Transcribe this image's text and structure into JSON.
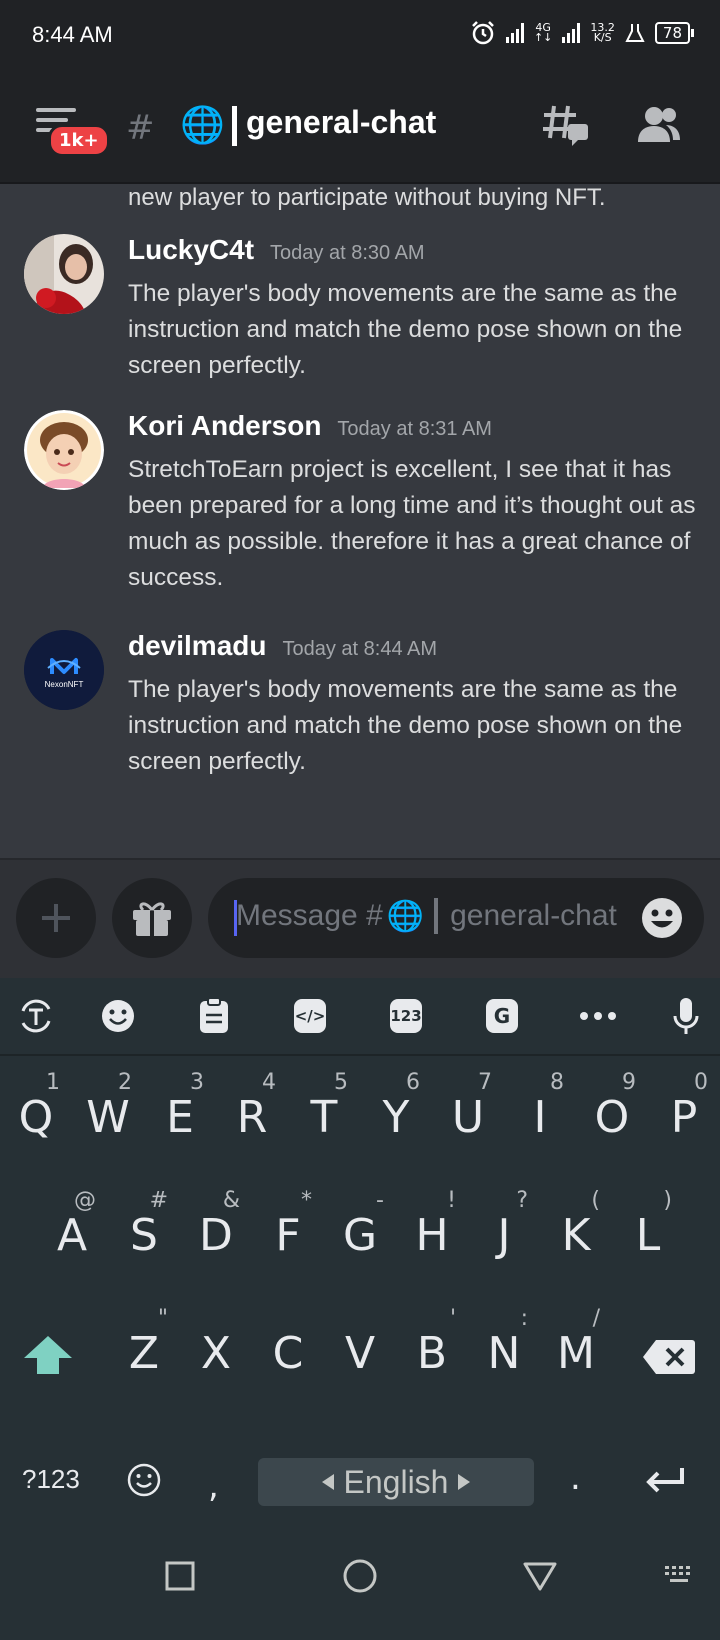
{
  "status_bar": {
    "time": "8:44 AM",
    "network_type": "4G",
    "speed_value": "13.2",
    "speed_unit": "K/S",
    "battery": "78"
  },
  "header": {
    "notification_badge": "1k+",
    "channel_emoji": "🌐",
    "channel_name": "general-chat"
  },
  "messages": {
    "partial_text": "new player to participate without buying NFT.",
    "items": [
      {
        "author": "LuckyC4t",
        "timestamp": "Today at 8:30 AM",
        "text": "The player's body movements are the same as the instruction and match the demo pose shown on the screen perfectly."
      },
      {
        "author": "Kori Anderson",
        "timestamp": "Today at 8:31 AM",
        "text": "StretchToEarn  project is excellent, I see that it has been prepared for a long time and it’s thought out as much as possible. therefore it has a great chance of success."
      },
      {
        "author": "devilmadu",
        "timestamp": "Today at 8:44 AM",
        "avatar_text": "NexonNFT",
        "text": "The player's body movements are the same as the instruction and match the demo pose shown on the screen perfectly."
      }
    ]
  },
  "composer": {
    "placeholder_prefix": "Message #",
    "placeholder_emoji": "🌐",
    "placeholder_channel": "general-chat"
  },
  "keyboard": {
    "toolbar_numbers_label": "123",
    "row1": [
      {
        "key": "Q",
        "hint": "1"
      },
      {
        "key": "W",
        "hint": "2"
      },
      {
        "key": "E",
        "hint": "3"
      },
      {
        "key": "R",
        "hint": "4"
      },
      {
        "key": "T",
        "hint": "5"
      },
      {
        "key": "Y",
        "hint": "6"
      },
      {
        "key": "U",
        "hint": "7"
      },
      {
        "key": "I",
        "hint": "8"
      },
      {
        "key": "O",
        "hint": "9"
      },
      {
        "key": "P",
        "hint": "0"
      }
    ],
    "row2": [
      {
        "key": "A",
        "hint": "@"
      },
      {
        "key": "S",
        "hint": "#"
      },
      {
        "key": "D",
        "hint": "&"
      },
      {
        "key": "F",
        "hint": "*"
      },
      {
        "key": "G",
        "hint": "-"
      },
      {
        "key": "H",
        "hint": "!"
      },
      {
        "key": "J",
        "hint": "?"
      },
      {
        "key": "K",
        "hint": "("
      },
      {
        "key": "L",
        "hint": ")"
      }
    ],
    "row3": [
      {
        "key": "Z",
        "hint": "\""
      },
      {
        "key": "X",
        "hint": ""
      },
      {
        "key": "C",
        "hint": ""
      },
      {
        "key": "V",
        "hint": ""
      },
      {
        "key": "B",
        "hint": "'"
      },
      {
        "key": "N",
        "hint": ":"
      },
      {
        "key": "M",
        "hint": "/"
      }
    ],
    "symbols_label": "?123",
    "comma": ",",
    "space_label": "English",
    "period": "."
  },
  "colors": {
    "background": "#36393f",
    "header": "#202225",
    "keyboard": "#263035",
    "badge": "#ed4245",
    "shift_accent": "#7fd1c2"
  }
}
